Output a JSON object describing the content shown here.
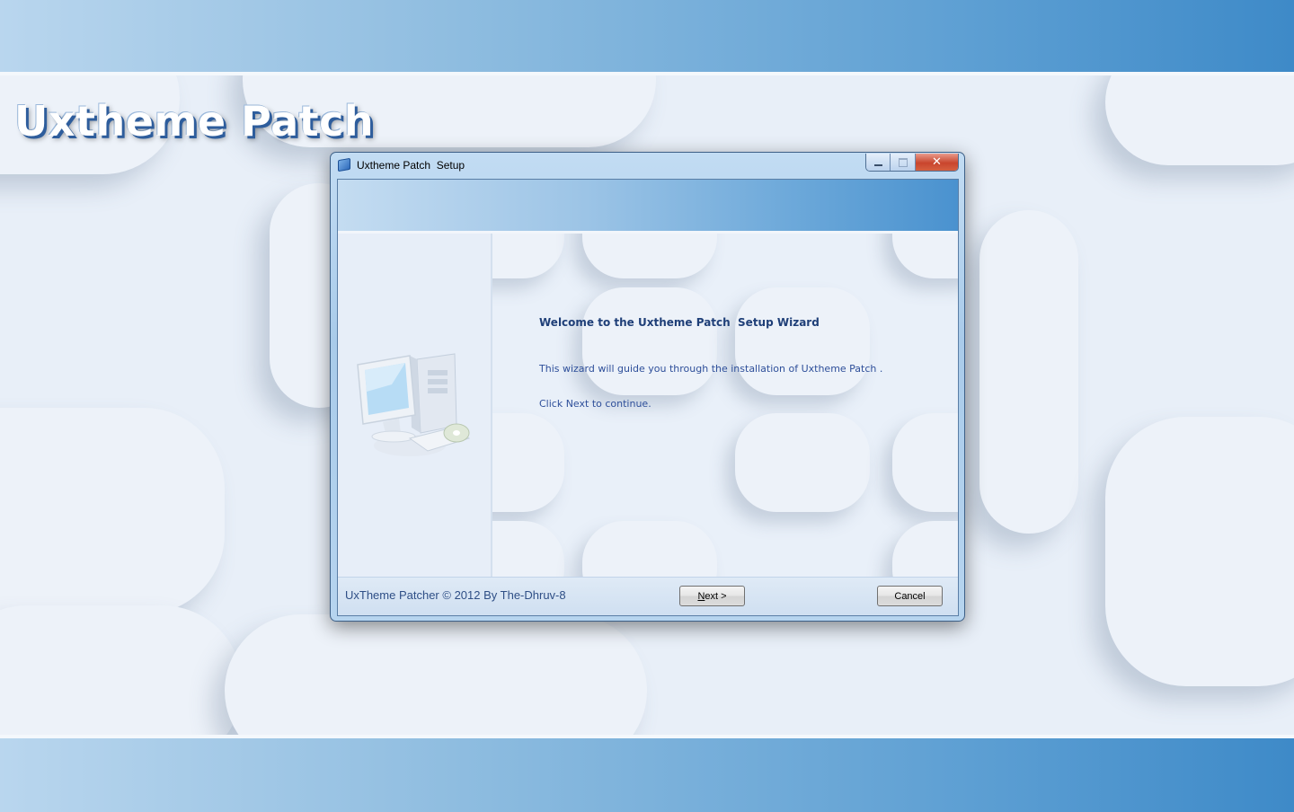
{
  "desktop": {
    "brand_title": "Uxtheme Patch"
  },
  "window": {
    "title": "Uxtheme Patch  Setup",
    "icon": "setup-app-icon",
    "controls": {
      "minimize_icon": "minimize-icon",
      "maximize_icon": "maximize-icon",
      "close_icon": "close-icon"
    }
  },
  "wizard": {
    "graphic_icon": "computer-with-disc-icon",
    "heading": "Welcome to the Uxtheme Patch  Setup Wizard",
    "intro": "This wizard will guide you through the installation of Uxtheme Patch .",
    "continue_hint": "Click Next to continue."
  },
  "footer": {
    "copyright": "UxTheme Patcher © 2012 By The-Dhruv-8",
    "next_mnemonic": "N",
    "next_rest": "ext >",
    "cancel_label": "Cancel"
  },
  "colors": {
    "accent_blue": "#4a92cf",
    "heading_text": "#1f3f78",
    "body_text": "#2e4f9a",
    "close_button": "#c9452d"
  }
}
